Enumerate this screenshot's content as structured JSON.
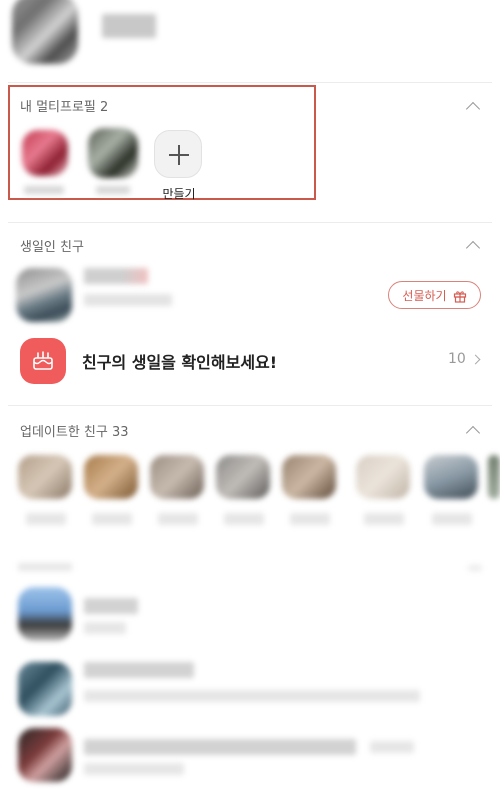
{
  "multi_profile": {
    "title": "내 멀티프로필 2",
    "add_label": "만들기"
  },
  "birthday": {
    "title": "생일인 친구",
    "gift_button": "선물하기",
    "check_message": "친구의 생일을 확인해보세요!",
    "check_count": "10"
  },
  "updated": {
    "title": "업데이트한 친구 33"
  },
  "icons": {
    "collapse": "chevron-up-icon",
    "add": "plus-icon",
    "gift": "gift-icon",
    "cake": "cake-icon",
    "more": "chevron-right-icon"
  },
  "colors": {
    "highlight_border": "#c9594a",
    "accent_red": "#f05b5b",
    "gift_text": "#d45d52"
  }
}
